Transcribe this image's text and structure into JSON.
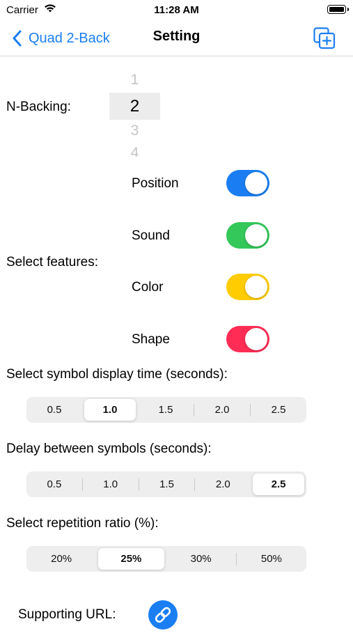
{
  "status_bar": {
    "carrier": "Carrier",
    "time": "11:28 AM"
  },
  "nav": {
    "back_label": "Quad 2-Back",
    "title": "Setting"
  },
  "n_backing": {
    "label": "N-Backing:",
    "options": [
      "1",
      "2",
      "3",
      "4"
    ],
    "selected": "2"
  },
  "features": {
    "label": "Select features:",
    "items": [
      {
        "label": "Position",
        "on": true,
        "color": "#1a7ef2"
      },
      {
        "label": "Sound",
        "on": true,
        "color": "#34c759"
      },
      {
        "label": "Color",
        "on": true,
        "color": "#ffcc00"
      },
      {
        "label": "Shape",
        "on": true,
        "color": "#ff2d55"
      }
    ]
  },
  "display_time": {
    "label": "Select symbol display time (seconds):",
    "options": [
      "0.5",
      "1.0",
      "1.5",
      "2.0",
      "2.5"
    ],
    "selected": "1.0"
  },
  "delay": {
    "label": "Delay between symbols (seconds):",
    "options": [
      "0.5",
      "1.0",
      "1.5",
      "2.0",
      "2.5"
    ],
    "selected": "2.5"
  },
  "repetition": {
    "label": "Select repetition ratio (%):",
    "options": [
      "20%",
      "25%",
      "30%",
      "50%"
    ],
    "selected": "25%"
  },
  "supporting_url": {
    "label": "Supporting URL:",
    "icon": "link-icon"
  },
  "colors": {
    "accent": "#1a7ef2"
  }
}
